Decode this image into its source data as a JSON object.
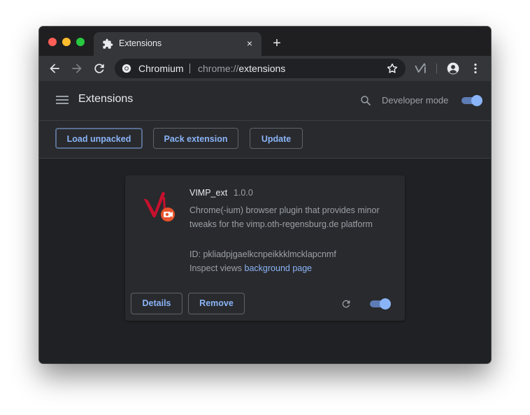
{
  "window": {
    "tab": {
      "title": "Extensions",
      "icon": "puzzle-piece-icon",
      "close": "×"
    },
    "new_tab_symbol": "+"
  },
  "toolbar": {
    "omnibox": {
      "origin": "Chromium",
      "url_scheme": "chrome://",
      "url_path": "extensions"
    }
  },
  "header": {
    "title": "Extensions",
    "developer_mode_label": "Developer mode",
    "developer_mode_on": true
  },
  "actions": {
    "load_unpacked": "Load unpacked",
    "pack_extension": "Pack extension",
    "update": "Update"
  },
  "extension": {
    "name": "VIMP_ext",
    "version": "1.0.0",
    "description": "Chrome(-ium) browser plugin that provides minor tweaks for the vimp.oth-regensburg.de platform",
    "id_text": "ID: pkliadpjgaelkcnpeikkklmcklapcnmf",
    "inspect_label": "Inspect views",
    "inspect_link": "background page",
    "details_label": "Details",
    "remove_label": "Remove",
    "enabled": true
  },
  "colors": {
    "accent": "#8ab4f8",
    "background": "#202124",
    "surface": "#292a2d",
    "toolbar": "#35363a",
    "logo_red": "#c8102e",
    "badge_orange": "#e8542c"
  }
}
